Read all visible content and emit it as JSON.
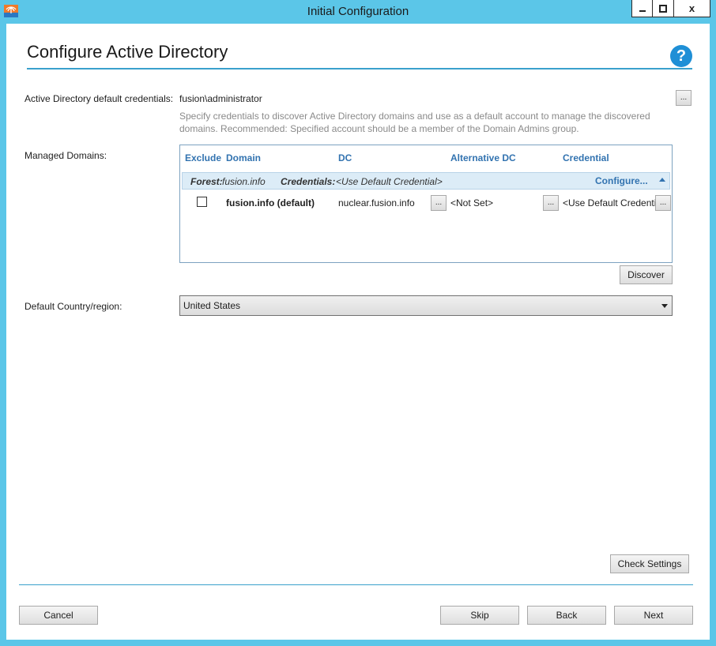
{
  "window": {
    "title": "Initial Configuration",
    "minimize_icon": "minimize-icon",
    "maximize_icon": "maximize-icon",
    "close_label": "x"
  },
  "page": {
    "title": "Configure Active Directory",
    "help_label": "?"
  },
  "credentials": {
    "label": "Active Directory default credentials:",
    "value": "fusion\\administrator",
    "browse_label": "...",
    "hint": "Specify credentials to discover Active Directory domains and use as a default account to manage the discovered domains. Recommended: Specified account should be a member of the Domain Admins group."
  },
  "managed_domains": {
    "label": "Managed Domains:",
    "columns": [
      "Exclude",
      "Domain",
      "DC",
      "Alternative DC",
      "Credential"
    ],
    "forest": {
      "forest_label": "Forest:",
      "forest_value": "fusion.info",
      "credentials_label": "Credentials:",
      "credentials_value": "<Use Default Credential>",
      "configure_label": "Configure..."
    },
    "rows": [
      {
        "excluded": false,
        "domain": "fusion.info (default)",
        "dc": "nuclear.fusion.info",
        "dc_browse": "...",
        "alt_dc": "<Not Set>",
        "alt_dc_browse": "...",
        "credential": "<Use Default Credential>",
        "credential_browse": "..."
      }
    ],
    "discover_label": "Discover"
  },
  "country": {
    "label": "Default Country/region:",
    "selected": "United States"
  },
  "buttons": {
    "check_settings": "Check Settings",
    "cancel": "Cancel",
    "skip": "Skip",
    "back": "Back",
    "next": "Next"
  },
  "colors": {
    "title_bar": "#5bc6e8",
    "accent_line": "#3aa0cc",
    "header_text": "#3273b0",
    "forest_row": "#dcecf7",
    "help_icon": "#1f8fd6"
  }
}
